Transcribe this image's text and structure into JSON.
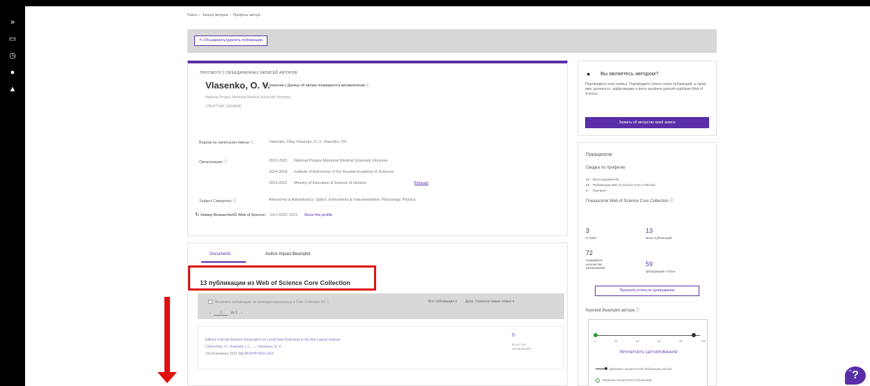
{
  "rail": {
    "icons": [
      "panel-toggle-icon",
      "folder-icon",
      "history-icon",
      "person-icon",
      "bell-icon"
    ],
    "glyphs": [
      "»",
      "▭",
      "◷",
      "●",
      "▲"
    ]
  },
  "breadcrumb": {
    "items": [
      "Поиск",
      "Записи авторов",
      "Профиль автора"
    ],
    "separator": "›"
  },
  "toolbar": {
    "merge_button": "✎ Объединить/удалить публикации"
  },
  "profile": {
    "overline": "ПРОСМОТР 2 ОБЪЕДИНЕННЫХ ЗАПИСЕЙ АВТОРОВ",
    "name": "Vlasenko, O. V.",
    "name_note": "Эти значения с Данных об авторе генерируются автоматически ⓘ",
    "affiliation": "National Pirogov Memorial Medical University Vinnytsia",
    "location": "VINNYTSIA, UKRAINE",
    "variants_label": "Варианты написания имени ⓘ",
    "variants": "Vlasenko, Oleg     Vlasenko, O. V.     Vlasenko, OV",
    "orgs_label": "Организации ⓘ",
    "orgs": [
      {
        "years": "2022-2022",
        "name": "National Pirogov Memorial Medical University Vinnytsia"
      },
      {
        "years": "2014-2018",
        "name": "Institute of Astronomy of the Russian Academy of Sciences"
      },
      {
        "years": "2014-2015",
        "name": "Ministry of Education & Science of Ukraine"
      }
    ],
    "more_link": "Больше",
    "subjects_label": "Subject Categories ⓘ",
    "subjects": "Astronomy & Astrophysics;  Optics;  Instruments & Instrumentation;  Physiology;  Physics",
    "researcher_label": "Номер ResearcherID Web of Science:",
    "researcher_id": "GGY-8992-2022",
    "show_profile": "Show this profile"
  },
  "docs": {
    "tab_documents": "Documents",
    "tab_beamplot": "Author Impact Beamplot",
    "heading": "13 публикации из Web of Science Core Collection",
    "filter_text": "Включить публикации, не проиндексированные в Core Collection (0)   ⓘ",
    "filter_all": "Все публикации ▾",
    "sort": "Дата: Сначала самые новые ▾",
    "pager_prev": "‹",
    "pager_page": "1",
    "pager_of": "из 1",
    "pager_next": "›",
    "publication": {
      "title": "Effects of Acute Ethanol Intoxication on Local Field Potentials in the Rat Lateral Septum",
      "authors": "Chehonina, O.; Kobylets, L.L.; ...; Vlasenko, O. V.",
      "meta_prefix": "Опубликовано 2021 ",
      "journal": "NEUROPHYSIOLOGY",
      "count": "0",
      "count_label": "Всего без цитирований"
    }
  },
  "claim": {
    "title": "Вы являетесь автором?",
    "description": "Подтвердите свою запись. Подтвердите список своих публикаций, а также имя, должность, аффилиацию и фото профиля данной подборки Web of Science.",
    "button": "Заявить об авторстве моей записи"
  },
  "metrics": {
    "title": "Показатели",
    "summary_title": "Сводка по профилю",
    "summary_lines": [
      {
        "num": "13",
        "label": "Всего документов"
      },
      {
        "num": "13",
        "label": "Публикации Web of Science Core Collection"
      },
      {
        "num": "0",
        "label": "Препринт"
      }
    ],
    "wos_title": "Показатели Web of Science Core Collection ⓘ",
    "h_index": "3",
    "h_index_label": "H-Index",
    "total_pubs": "13",
    "total_pubs_label": "Всего публикаций",
    "sum_cites": "72",
    "sum_cites_label": "Суммарное количество цитирований",
    "citing_articles": "59",
    "citing_articles_label": "Цитирующие статьи",
    "report_button": "Просмотр отчета по цитированию",
    "beamplot_title": "Краткий Beamplot автора ⓘ",
    "beamplot_ticks": [
      "0",
      "20",
      "40",
      "60",
      "80",
      "100"
    ],
    "beamplot_cta": "ПРОЧИТАТЬ ЦИТИРОВАНИЯ",
    "legend_1": "Диапазон процентилей публикации автора",
    "legend_2": "Медиана процентиля публикаций"
  },
  "help": {
    "glyph": "?",
    "badge": "10"
  },
  "colors": {
    "accent": "#5a2ea8",
    "annotation": "#e01010",
    "rail": "#000000"
  }
}
